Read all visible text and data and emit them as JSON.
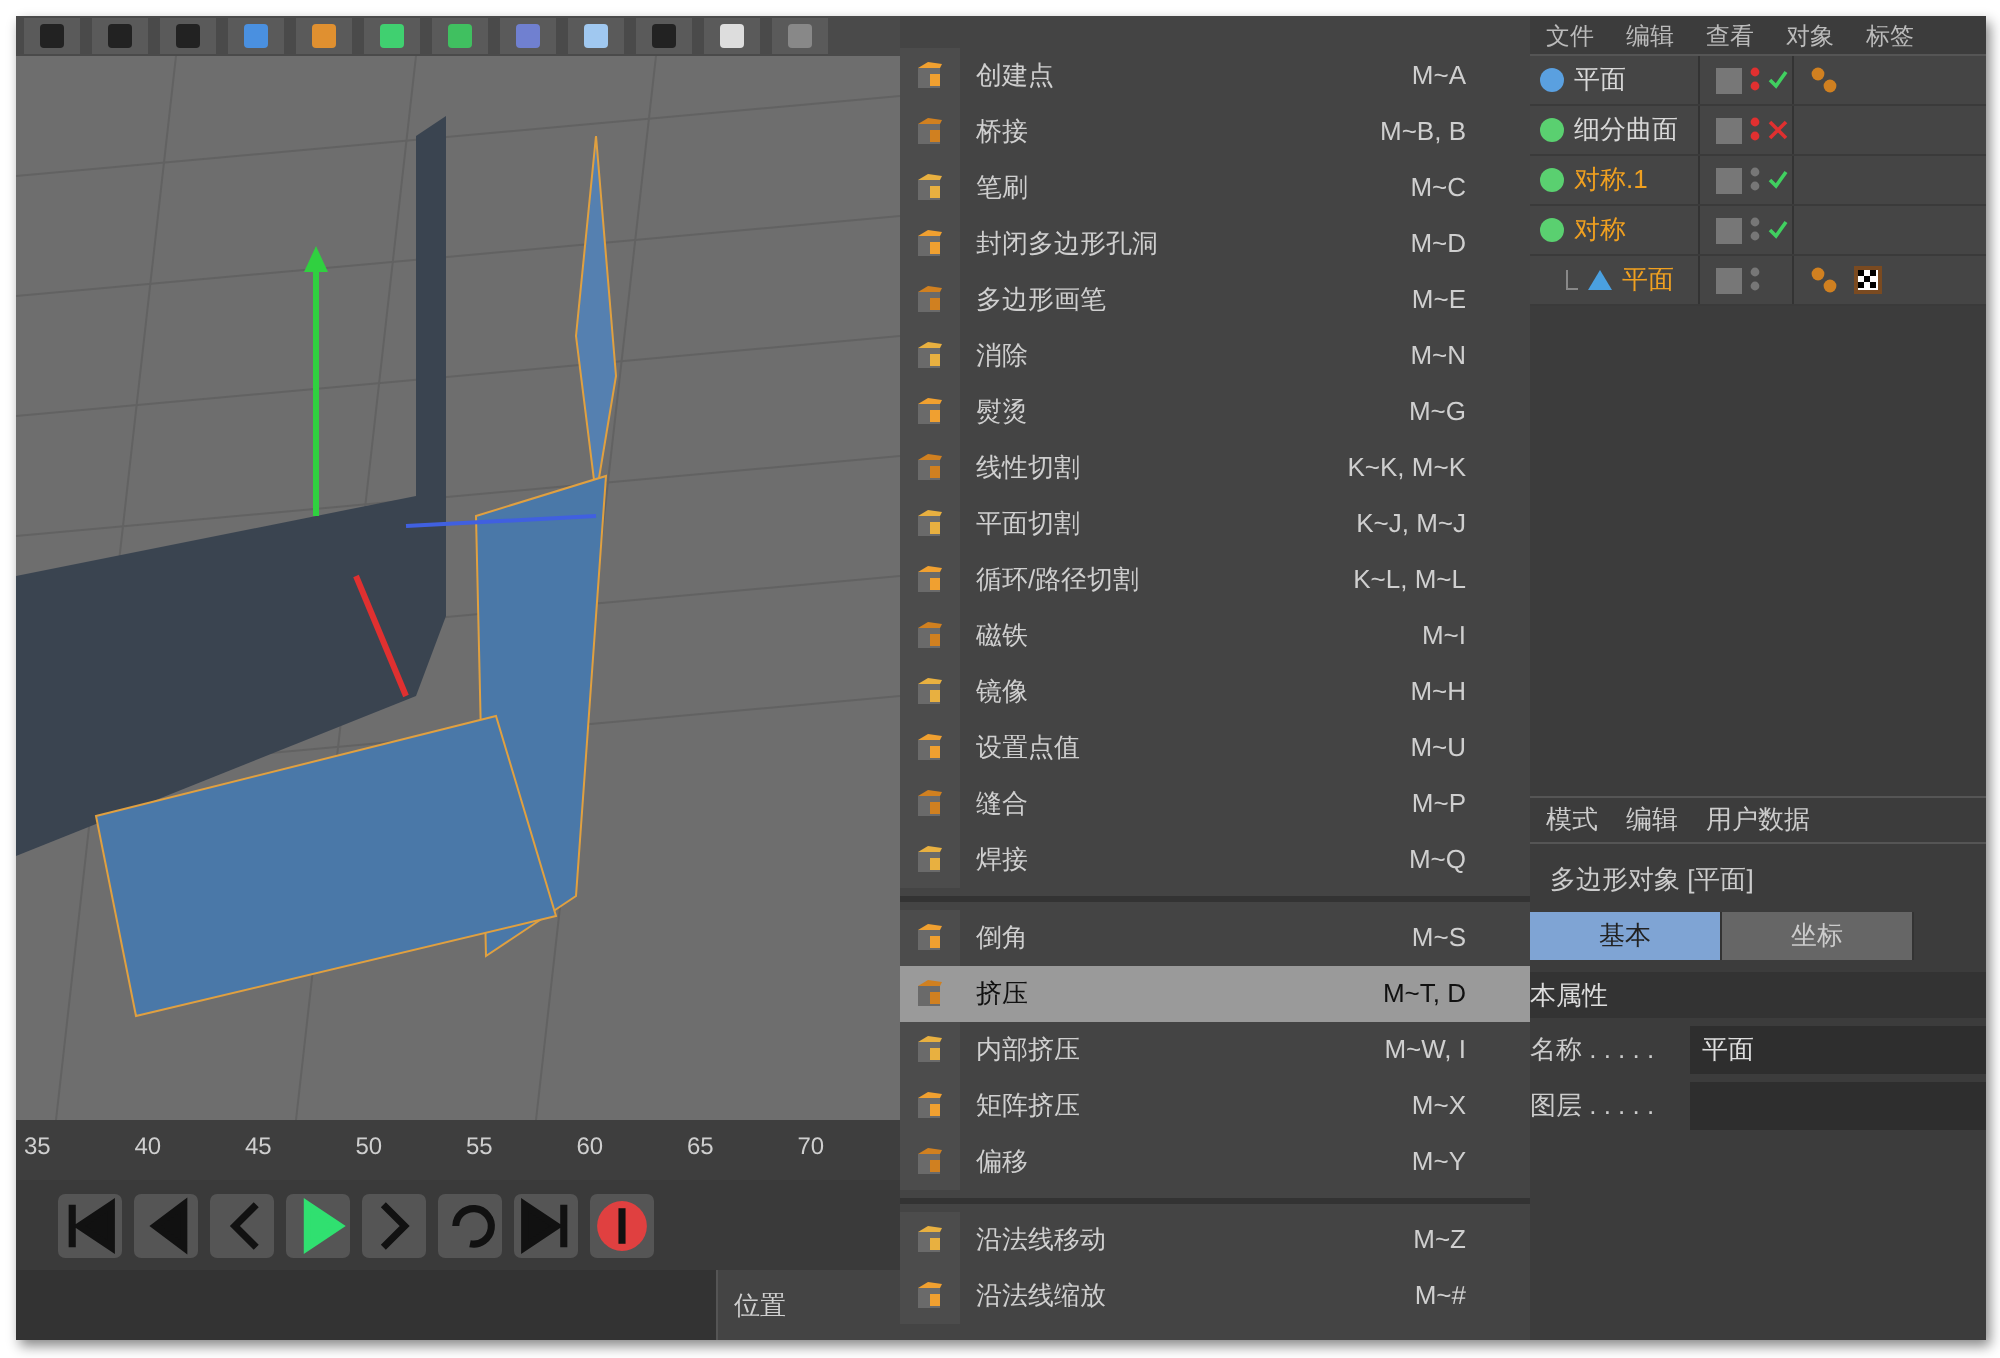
{
  "timeline": {
    "ticks": [
      "35",
      "40",
      "45",
      "50",
      "55",
      "60",
      "65",
      "70"
    ]
  },
  "bottom_panel": {
    "title": "位置"
  },
  "context_menu": {
    "groups": [
      [
        {
          "label": "创建点",
          "shortcut": "M~A",
          "selected": false
        },
        {
          "label": "桥接",
          "shortcut": "M~B, B",
          "selected": false
        },
        {
          "label": "笔刷",
          "shortcut": "M~C",
          "selected": false
        },
        {
          "label": "封闭多边形孔洞",
          "shortcut": "M~D",
          "selected": false
        },
        {
          "label": "多边形画笔",
          "shortcut": "M~E",
          "selected": false
        },
        {
          "label": "消除",
          "shortcut": "M~N",
          "selected": false
        },
        {
          "label": "熨烫",
          "shortcut": "M~G",
          "selected": false
        },
        {
          "label": "线性切割",
          "shortcut": "K~K, M~K",
          "selected": false
        },
        {
          "label": "平面切割",
          "shortcut": "K~J, M~J",
          "selected": false
        },
        {
          "label": "循环/路径切割",
          "shortcut": "K~L, M~L",
          "selected": false
        },
        {
          "label": "磁铁",
          "shortcut": "M~I",
          "selected": false
        },
        {
          "label": "镜像",
          "shortcut": "M~H",
          "selected": false
        },
        {
          "label": "设置点值",
          "shortcut": "M~U",
          "selected": false
        },
        {
          "label": "缝合",
          "shortcut": "M~P",
          "selected": false
        },
        {
          "label": "焊接",
          "shortcut": "M~Q",
          "selected": false
        }
      ],
      [
        {
          "label": "倒角",
          "shortcut": "M~S",
          "selected": false
        },
        {
          "label": "挤压",
          "shortcut": "M~T, D",
          "selected": true
        },
        {
          "label": "内部挤压",
          "shortcut": "M~W, I",
          "selected": false
        },
        {
          "label": "矩阵挤压",
          "shortcut": "M~X",
          "selected": false
        },
        {
          "label": "偏移",
          "shortcut": "M~Y",
          "selected": false
        }
      ],
      [
        {
          "label": "沿法线移动",
          "shortcut": "M~Z",
          "selected": false
        },
        {
          "label": "沿法线缩放",
          "shortcut": "M~#",
          "selected": false
        }
      ]
    ]
  },
  "object_manager": {
    "menu": [
      "文件",
      "编辑",
      "查看",
      "对象",
      "标签"
    ],
    "objects": [
      {
        "name": "平面",
        "selected": false,
        "enabled": true,
        "tags": true
      },
      {
        "name": "细分曲面",
        "selected": false,
        "enabled": false,
        "tags": false
      },
      {
        "name": "对称.1",
        "selected": true,
        "enabled": true,
        "tags": false
      },
      {
        "name": "对称",
        "selected": true,
        "enabled": true,
        "tags": false,
        "children": [
          {
            "name": "平面",
            "selected": true,
            "tags": true
          }
        ]
      }
    ]
  },
  "attributes": {
    "menu": [
      "模式",
      "编辑",
      "用户数据"
    ],
    "title": "多边形对象 [平面]",
    "tabs": [
      {
        "label": "基本",
        "selected": true
      },
      {
        "label": "坐标",
        "selected": false
      }
    ],
    "section": "本属性",
    "fields": [
      {
        "label": "名称 . . . . .",
        "value": "平面"
      },
      {
        "label": "图层 . . . . ."
      }
    ]
  }
}
